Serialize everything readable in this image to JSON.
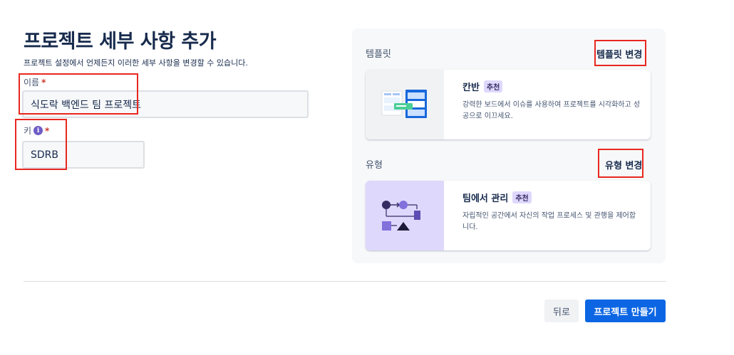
{
  "header": {
    "title": "프로젝트 세부 사항 추가",
    "description": "프로젝트 설정에서 언제든지 이러한 세부 사항을 변경할 수 있습니다."
  },
  "form": {
    "name": {
      "label": "이름",
      "required_mark": "*",
      "value": "식도락 백엔드 팀 프로젝트"
    },
    "key": {
      "label": "키",
      "info_glyph": "i",
      "required_mark": "*",
      "value": "SDRB"
    }
  },
  "template": {
    "section_label": "템플릿",
    "change_label": "템플릿 변경",
    "card": {
      "title": "칸반",
      "badge": "추천",
      "description": "강력한 보드에서 이슈를 사용하여 프로젝트를 시각화하고 성공으로 이끄세요.",
      "thumb_icon": "kanban-board-illustration"
    }
  },
  "type": {
    "section_label": "유형",
    "change_label": "유형 변경",
    "card": {
      "title": "팀에서 관리",
      "badge": "추천",
      "description": "자립적인 공간에서 자신의 작업 프로세스 및 관행을 제어합니다.",
      "thumb_icon": "team-managed-workflow-illustration"
    }
  },
  "actions": {
    "back_label": "뒤로",
    "create_label": "프로젝트 만들기"
  },
  "colors": {
    "primary": "#0c66e4",
    "highlight_box": "#e8281f",
    "badge_bg": "#dfd8fd",
    "panel_bg": "#f7f8f9"
  }
}
